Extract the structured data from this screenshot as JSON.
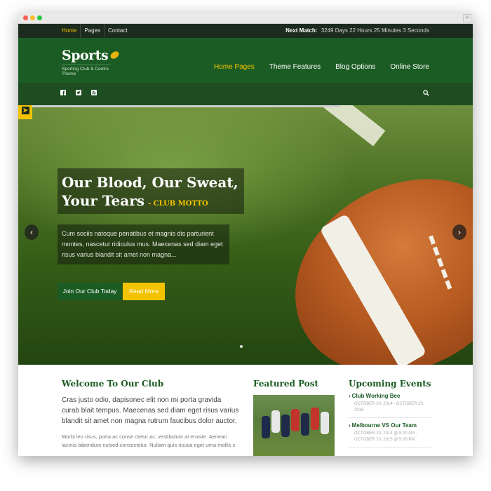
{
  "topbar": {
    "nav": [
      "Home",
      "Pages",
      "Contact"
    ],
    "next_match_label": "Next Match:",
    "countdown": "3249 Days 22 Hours 25 Minutes 3 Seconds"
  },
  "header": {
    "logo_title": "Sports",
    "logo_tagline": "Sporting Club & Centre Theme",
    "nav": [
      "Home Pages",
      "Theme Features",
      "Blog Options",
      "Online Store"
    ]
  },
  "social": {
    "icons": [
      "facebook-icon",
      "twitter-icon",
      "rss-icon",
      "search-icon"
    ]
  },
  "hero": {
    "headline_line1": "Our Blood, Our Sweat,",
    "headline_line2": "Your Tears",
    "motto": "- CLUB MOTTO",
    "intro": "Cum sociis natoque penatibus et magnis dis parturient montes, nascetur ridiculus mus. Maecenas sed diam eget risus varius blandit sit amet non magna...",
    "join_button": "Join Our Club Today",
    "read_button": "Read More"
  },
  "welcome": {
    "title": "Welcome To Our Club",
    "lead": "Cras justo odio, dapisonec elit non mi porta gravida curab blait tempus. Maecenas sed diam eget risus varius blandit sit amet non magna rutrum faucibus dolor auctor.",
    "body": "Morbi leo risus, porta ac conse ctetur ac, vestibulum at erosite. Aenean lacinia bibendum nulsed consectetur. Nullam quis risusa eget urna mollis s"
  },
  "featured": {
    "title": "Featured Post"
  },
  "upcoming": {
    "title": "Upcoming Events",
    "events": [
      {
        "title": "Club Working Bee",
        "date": "OCTOBER 20, 2014 - OCTOBER 20, 2016"
      },
      {
        "title": "Melbourne VS Our Team",
        "date": "OCTOBER 20, 2014 @ 8:00 AM - OCTOBER 20, 2015 @ 5:00 PM"
      }
    ]
  },
  "colors": {
    "brand_green": "#1b5c24",
    "accent_yellow": "#f3c300",
    "topbar_dark": "#1c2b1e"
  }
}
